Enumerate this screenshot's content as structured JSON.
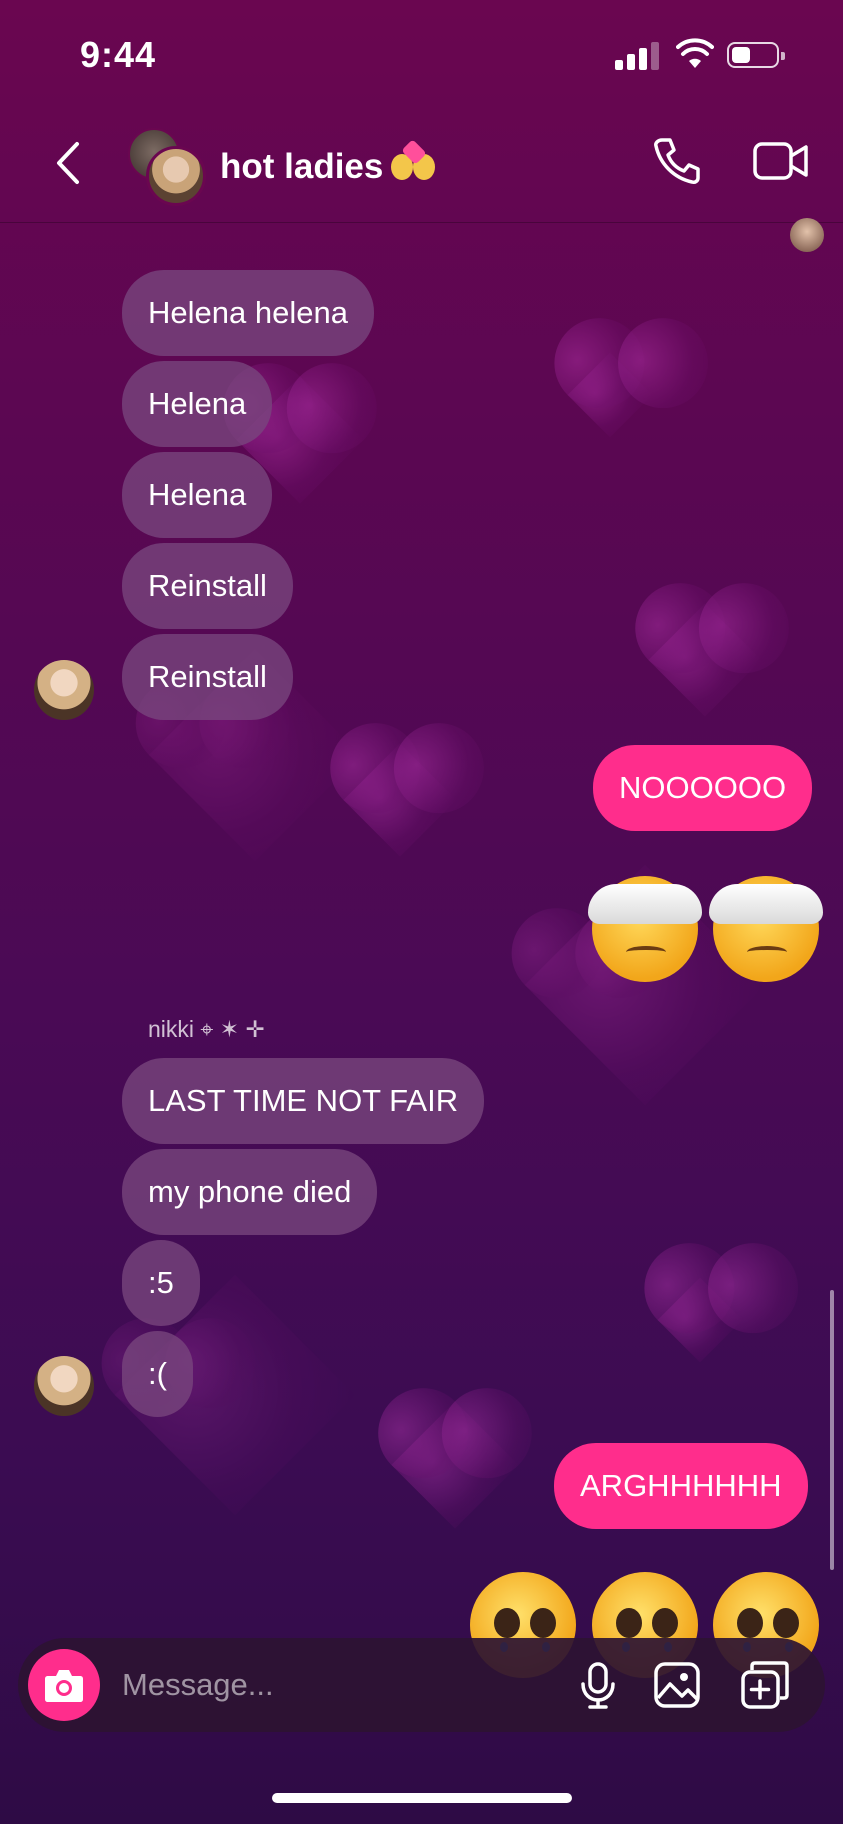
{
  "status": {
    "time": "9:44"
  },
  "header": {
    "title": "hot ladies"
  },
  "messages": {
    "m1": "Helena helena",
    "m2": "Helena",
    "m3": "Helena",
    "m4": "Reinstall",
    "m5": "Reinstall",
    "mine1": "NOOOOOO",
    "sender": "nikki ⌖ ✶ ✛",
    "m6": "LAST TIME NOT FAIR",
    "m7": "my phone died",
    "m8": ":5",
    "m9": ":(",
    "mine2": "ARGHHHHHH"
  },
  "composer": {
    "placeholder": "Message..."
  },
  "colors": {
    "accent": "#ff2d8c",
    "received_bubble": "#784680",
    "background_top": "#6a0650",
    "background_bottom": "#2e0b45"
  },
  "icons": [
    "back-chevron-icon",
    "phone-icon",
    "video-camera-icon",
    "camera-icon",
    "microphone-icon",
    "gallery-icon",
    "sticker-icon"
  ]
}
